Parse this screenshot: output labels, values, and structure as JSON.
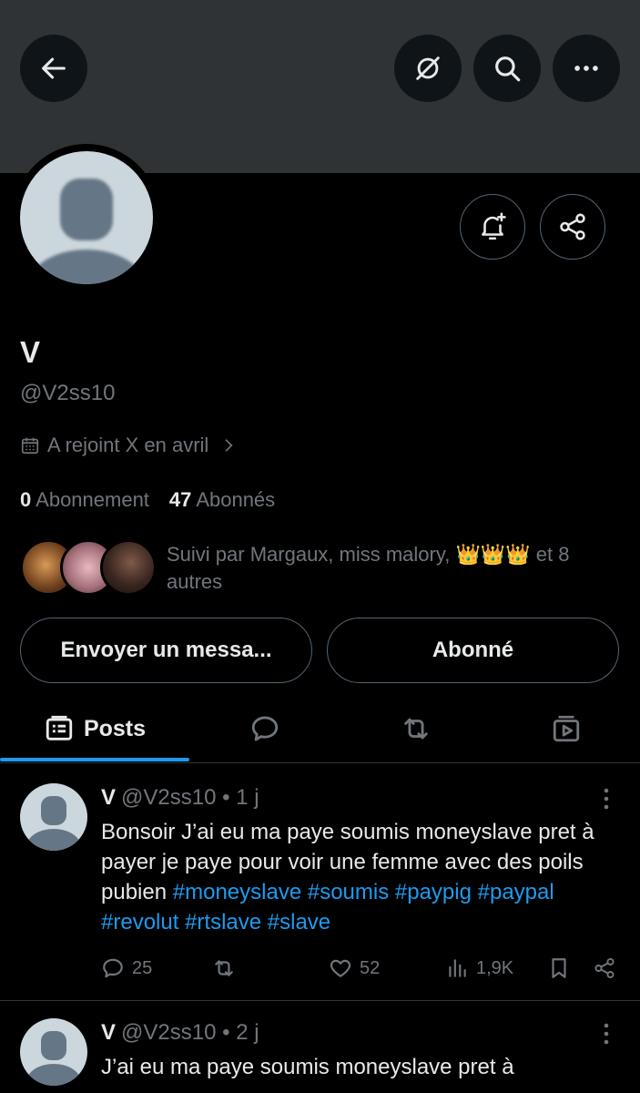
{
  "header": {
    "back_icon": "arrow-left-icon",
    "grok_icon": "grok-icon",
    "search_icon": "search-icon",
    "more_icon": "more-horizontal-icon"
  },
  "profile": {
    "display_name": "V",
    "handle": "@V2ss10",
    "joined": "A rejoint X en avril",
    "following_count": "0",
    "following_label": "Abonnement",
    "followers_count": "47",
    "followers_label": "Abonnés",
    "followed_by_prefix": "Suivi par Margaux, miss malory,",
    "followed_by_crowns": "👑👑👑",
    "followed_by_suffix": "et 8 autres"
  },
  "buttons": {
    "message": "Envoyer un messa...",
    "subscribed": "Abonné"
  },
  "tabs": [
    {
      "label": "Posts",
      "icon": "posts-icon",
      "active": true
    },
    {
      "label": "",
      "icon": "reply-icon",
      "active": false
    },
    {
      "label": "",
      "icon": "repost-icon",
      "active": false
    },
    {
      "label": "",
      "icon": "media-icon",
      "active": false
    }
  ],
  "posts": [
    {
      "author": "V",
      "handle": "@V2ss10",
      "separator": "•",
      "time": "1 j",
      "text": "Bonsoir J’ai eu ma paye soumis moneyslave pret à payer je paye pour voir une femme avec des poils pubien",
      "hashtags": [
        "#moneyslave",
        "#soumis",
        "#paypig",
        "#paypal",
        "#revolut",
        "#rtslave",
        "#slave"
      ],
      "replies": "25",
      "likes": "52",
      "views": "1,9K"
    },
    {
      "author": "V",
      "handle": "@V2ss10",
      "separator": "•",
      "time": "2 j",
      "text": "J’ai eu ma paye soumis moneyslave pret à"
    }
  ],
  "colors": {
    "background": "#000000",
    "banner": "#2f3336",
    "accent": "#1d9bf0",
    "muted": "#71767b",
    "text": "#e7e9ea"
  }
}
